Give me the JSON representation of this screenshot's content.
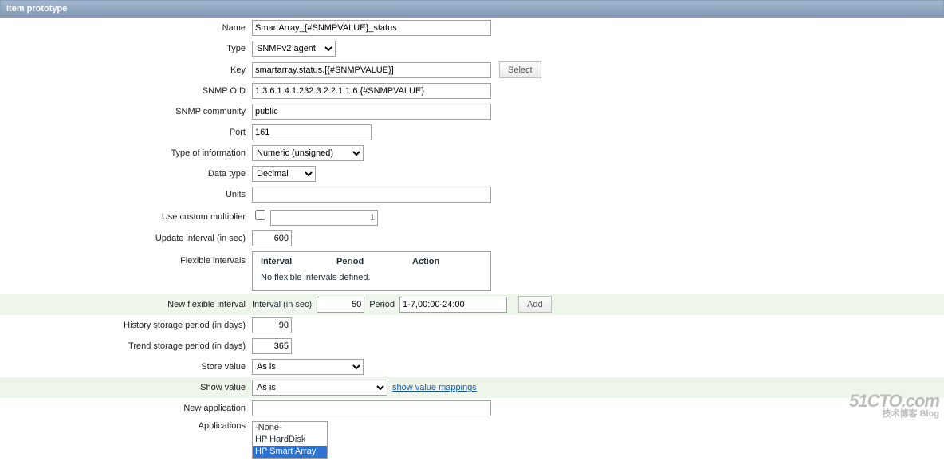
{
  "header": {
    "title": "Item prototype"
  },
  "labels": {
    "name": "Name",
    "type": "Type",
    "key": "Key",
    "snmp_oid": "SNMP OID",
    "snmp_community": "SNMP community",
    "port": "Port",
    "type_of_information": "Type of information",
    "data_type": "Data type",
    "units": "Units",
    "use_custom_multiplier": "Use custom multiplier",
    "update_interval": "Update interval (in sec)",
    "flexible_intervals": "Flexible intervals",
    "new_flexible_interval": "New flexible interval",
    "history_storage": "History storage period (in days)",
    "trend_storage": "Trend storage period (in days)",
    "store_value": "Store value",
    "show_value": "Show value",
    "new_application": "New application",
    "applications": "Applications"
  },
  "fields": {
    "name": "SmartArray_{#SNMPVALUE}_status",
    "type": "SNMPv2 agent",
    "key": "smartarray.status.[{#SNMPVALUE}]",
    "snmp_oid": "1.3.6.1.4.1.232.3.2.2.1.1.6.{#SNMPVALUE}",
    "snmp_community": "public",
    "port": "161",
    "type_of_information": "Numeric (unsigned)",
    "data_type": "Decimal",
    "units": "",
    "use_custom_multiplier_checked": false,
    "use_custom_multiplier_value": "1",
    "update_interval": "600",
    "flex_col_interval": "Interval",
    "flex_col_period": "Period",
    "flex_col_action": "Action",
    "flex_empty_text": "No flexible intervals defined.",
    "new_flex_interval_label": "Interval (in sec)",
    "new_flex_interval_value": "50",
    "new_flex_period_label": "Period",
    "new_flex_period_value": "1-7,00:00-24:00",
    "history_storage": "90",
    "trend_storage": "365",
    "store_value": "As is",
    "show_value": "As is",
    "new_application": "",
    "applications": [
      "-None-",
      "HP HardDisk",
      "HP Smart Array"
    ],
    "applications_selected": "HP Smart Array"
  },
  "buttons": {
    "select": "Select",
    "add": "Add"
  },
  "links": {
    "show_value_mappings": "show value mappings"
  },
  "watermark": {
    "line1": "51CTO.com",
    "line2": "技术博客   Blog"
  }
}
